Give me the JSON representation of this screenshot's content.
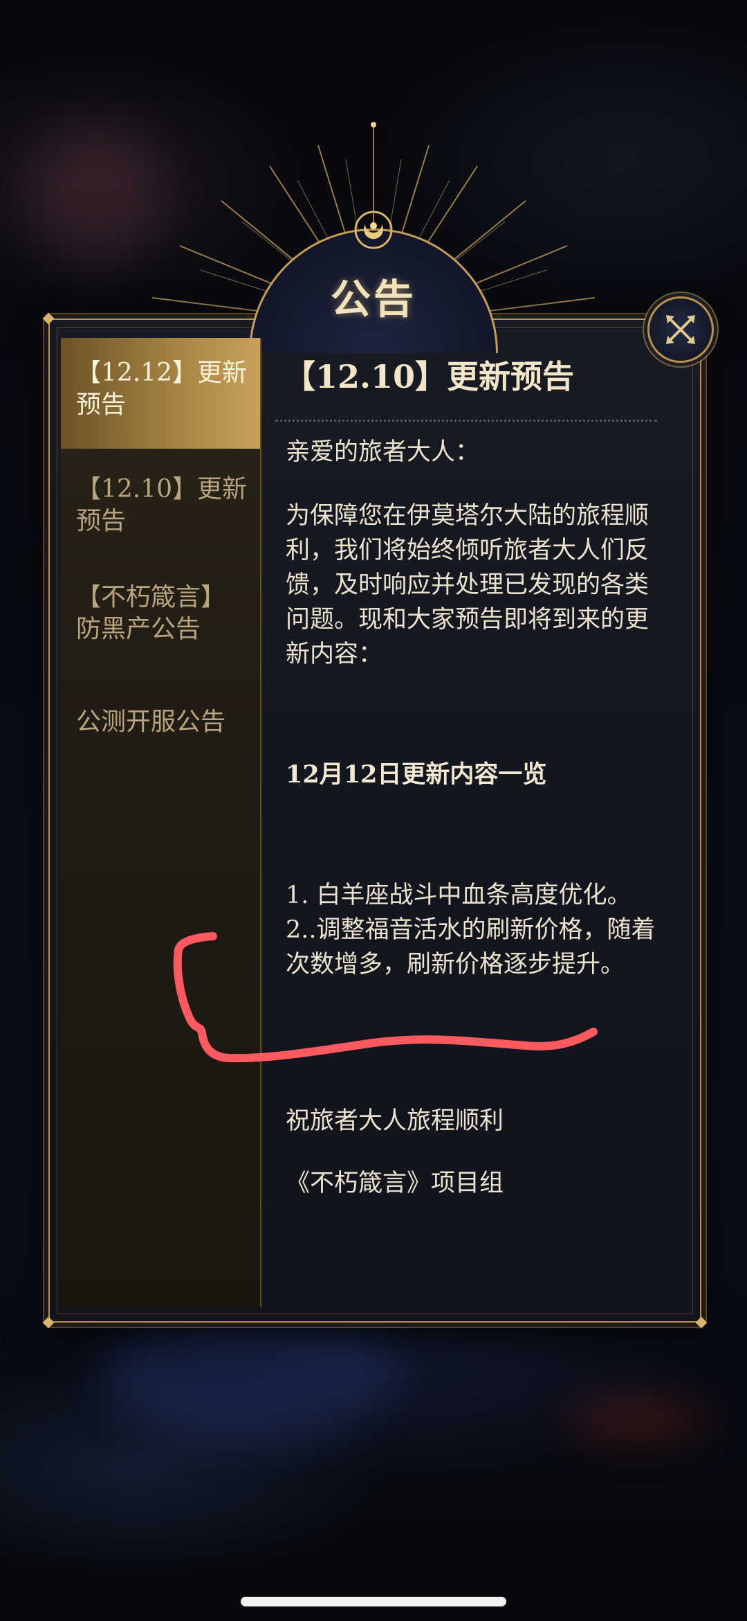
{
  "title": "公告",
  "sidebar": {
    "items": [
      {
        "label": "【12.12】更新预告",
        "active": true
      },
      {
        "label": "【12.10】更新预告",
        "active": false
      },
      {
        "label": "【不朽箴言】防黑产公告",
        "active": false
      },
      {
        "label": "公测开服公告",
        "active": false
      }
    ]
  },
  "content": {
    "title": "【12.10】更新预告",
    "greeting": "亲爱的旅者大人：",
    "body": "为保障您在伊莫塔尔大陆的旅程顺利，我们将始终倾听旅者大人们反馈，及时响应并处理已发现的各类问题。现和大家预告即将到来的更新内容：",
    "section_heading": "12月12日更新内容一览",
    "items": [
      "1. 白羊座战斗中血条高度优化。",
      "2..调整福音活水的刷新价格，随着次数增多，刷新价格逐步提升。"
    ],
    "closing": "祝旅者大人旅程顺利",
    "signature": "《不朽箴言》项目组"
  },
  "icons": {
    "close": "close-x-icon",
    "emblem": "moon-emblem-icon"
  },
  "colors": {
    "gold": "#b8924e",
    "active_tab": "#a98544",
    "text": "#ece3cf",
    "annotation": "#ff5a5f"
  }
}
